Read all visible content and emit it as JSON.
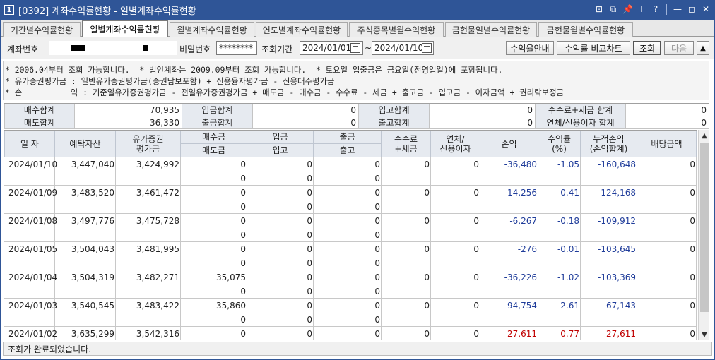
{
  "window": {
    "number": "1",
    "title": "[0392] 계좌수익률현황 - 일별계좌수익률현황",
    "controls": [
      "⊡",
      "⧉",
      "📌",
      "T",
      "?",
      "—",
      "◻",
      "✕"
    ]
  },
  "tabs": [
    "기간별수익률현황",
    "일별계좌수익률현황",
    "월별계좌수익률현황",
    "연도별계좌수익률현황",
    "주식종목별월수익현황",
    "금현물일별수익률현황",
    "금현물월별수익률현황"
  ],
  "search": {
    "account_label": "계좌번호",
    "password_label": "비밀번호",
    "password_value": "********",
    "period_label": "조회기간",
    "date_from": "2024/01/01",
    "tilde": "~",
    "date_to": "2024/01/10",
    "btn_guide": "수익율안내",
    "btn_compare": "수익률 비교차트",
    "btn_query": "조회",
    "btn_next": "다음",
    "btn_up": "▲"
  },
  "notes": [
    "* 2006.04부터 조회 가능합니다.  * 법인계좌는 2009.09부터 조회 가능합니다.  * 토요일 입출금은 금요일(전영업일)에 포함됩니다.",
    "* 유가증권평가금 : 일반유가증권평가금(증권담보포함) + 신용융자평가금 - 신용대주평가금",
    "* 손          익 : 기준일유가증권평가금 - 전일유가증권평가금 + 매도금 - 매수금 - 수수료 - 세금 + 출고금 - 입고금 - 이자금액 + 권리락보정금"
  ],
  "summary": {
    "row1": [
      {
        "label": "매수합계",
        "value": "70,935"
      },
      {
        "label": "입금합계",
        "value": "0"
      },
      {
        "label": "입고합계",
        "value": "0"
      },
      {
        "label": "수수료+세금 합계",
        "value": "0"
      }
    ],
    "row2": [
      {
        "label": "매도합계",
        "value": "36,330"
      },
      {
        "label": "출금합계",
        "value": "0"
      },
      {
        "label": "출고합계",
        "value": "0"
      },
      {
        "label": "연체/신용이자 합계",
        "value": "0"
      }
    ]
  },
  "grid": {
    "headers": {
      "date": "일 자",
      "deposit": "예탁자산",
      "securities": "유가증권\n평가금",
      "buy_top": "매수금",
      "sell_bottom": "매도금",
      "deposit_in_top": "입금",
      "stock_in_bottom": "입고",
      "withdraw_top": "출금",
      "stock_out_bottom": "출고",
      "fee": "수수료\n+세금",
      "interest": "연체/\n신용이자",
      "pnl": "손익",
      "return": "수익률\n(%)",
      "cum_pnl": "누적손익\n(손익합계)",
      "dividend": "배당금액"
    },
    "rows": [
      {
        "date": "2024/01/10",
        "deposit": "3,447,040",
        "securities": "3,424,992",
        "buy": "0",
        "sell": "0",
        "dep_in": "0",
        "stock_in": "0",
        "withdraw": "0",
        "stock_out": "0",
        "fee": "0",
        "interest": "0",
        "pnl": "-36,480",
        "ret": "-1.05",
        "cum": "-160,648",
        "div": "0",
        "sign": "neg"
      },
      {
        "date": "2024/01/09",
        "deposit": "3,483,520",
        "securities": "3,461,472",
        "buy": "0",
        "sell": "0",
        "dep_in": "0",
        "stock_in": "0",
        "withdraw": "0",
        "stock_out": "0",
        "fee": "0",
        "interest": "0",
        "pnl": "-14,256",
        "ret": "-0.41",
        "cum": "-124,168",
        "div": "0",
        "sign": "neg"
      },
      {
        "date": "2024/01/08",
        "deposit": "3,497,776",
        "securities": "3,475,728",
        "buy": "0",
        "sell": "0",
        "dep_in": "0",
        "stock_in": "0",
        "withdraw": "0",
        "stock_out": "0",
        "fee": "0",
        "interest": "0",
        "pnl": "-6,267",
        "ret": "-0.18",
        "cum": "-109,912",
        "div": "0",
        "sign": "neg"
      },
      {
        "date": "2024/01/05",
        "deposit": "3,504,043",
        "securities": "3,481,995",
        "buy": "0",
        "sell": "0",
        "dep_in": "0",
        "stock_in": "0",
        "withdraw": "0",
        "stock_out": "0",
        "fee": "0",
        "interest": "0",
        "pnl": "-276",
        "ret": "-0.01",
        "cum": "-103,645",
        "div": "0",
        "sign": "neg"
      },
      {
        "date": "2024/01/04",
        "deposit": "3,504,319",
        "securities": "3,482,271",
        "buy": "35,075",
        "sell": "0",
        "dep_in": "0",
        "stock_in": "0",
        "withdraw": "0",
        "stock_out": "0",
        "fee": "0",
        "interest": "0",
        "pnl": "-36,226",
        "ret": "-1.02",
        "cum": "-103,369",
        "div": "0",
        "sign": "neg"
      },
      {
        "date": "2024/01/03",
        "deposit": "3,540,545",
        "securities": "3,483,422",
        "buy": "35,860",
        "sell": "0",
        "dep_in": "0",
        "stock_in": "0",
        "withdraw": "0",
        "stock_out": "0",
        "fee": "0",
        "interest": "0",
        "pnl": "-94,754",
        "ret": "-2.61",
        "cum": "-67,143",
        "div": "0",
        "sign": "neg"
      },
      {
        "date": "2024/01/02",
        "deposit": "3,635,299",
        "securities": "3,542,316",
        "buy": "0",
        "sell": "0",
        "dep_in": "0",
        "stock_in": "0",
        "withdraw": "0",
        "stock_out": "0",
        "fee": "0",
        "interest": "0",
        "pnl": "27,611",
        "ret": "0.77",
        "cum": "27,611",
        "div": "0",
        "sign": "pos"
      }
    ]
  },
  "status": "조회가 완료되었습니다.",
  "colors": {
    "title_bg": "#2f5597",
    "negative": "#1f3c9a",
    "positive": "#c00000",
    "header_bg": "#e6eaf0"
  }
}
